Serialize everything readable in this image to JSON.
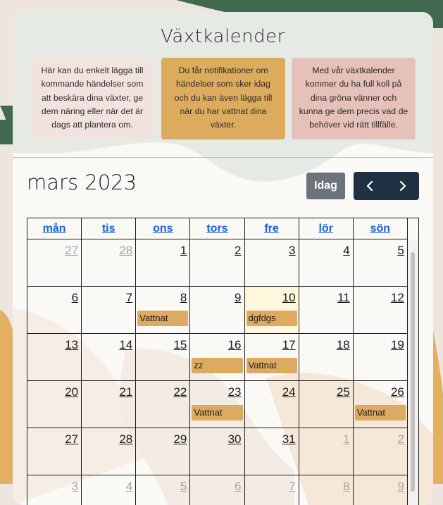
{
  "page": {
    "title": "Växtkalender"
  },
  "info_boxes": [
    {
      "text": "Här kan du enkelt lägga till kommande händelser som att beskära dina växter, ge dem näring eller när det är dags att plantera om."
    },
    {
      "text": "Du får notifikationer om händelser som sker idag och du kan även lägga till när du har vattnat dina växter."
    },
    {
      "text": "Med vår växtkalender kommer du ha full koll på dina gröna vänner och kunna ge dem precis vad de behöver vid rätt tillfälle."
    }
  ],
  "calendar": {
    "month_title": "mars 2023",
    "today_label": "Idag",
    "prev_icon": "chevron-left-icon",
    "next_icon": "chevron-right-icon",
    "weekdays": [
      "mån",
      "tis",
      "ons",
      "tors",
      "fre",
      "lör",
      "sön"
    ],
    "weeks": [
      [
        {
          "n": "27",
          "o": true
        },
        {
          "n": "28",
          "o": true
        },
        {
          "n": "1"
        },
        {
          "n": "2"
        },
        {
          "n": "3"
        },
        {
          "n": "4"
        },
        {
          "n": "5"
        }
      ],
      [
        {
          "n": "6"
        },
        {
          "n": "7"
        },
        {
          "n": "8",
          "ev": "Vattnat"
        },
        {
          "n": "9"
        },
        {
          "n": "10",
          "ev": "dgfdgs",
          "today": true
        },
        {
          "n": "11"
        },
        {
          "n": "12"
        }
      ],
      [
        {
          "n": "13"
        },
        {
          "n": "14"
        },
        {
          "n": "15"
        },
        {
          "n": "16",
          "ev": "zz"
        },
        {
          "n": "17",
          "ev": "Vattnat"
        },
        {
          "n": "18"
        },
        {
          "n": "19"
        }
      ],
      [
        {
          "n": "20"
        },
        {
          "n": "21"
        },
        {
          "n": "22"
        },
        {
          "n": "23",
          "ev": "Vattnat"
        },
        {
          "n": "24"
        },
        {
          "n": "25"
        },
        {
          "n": "26",
          "ev": "Vattnat"
        }
      ],
      [
        {
          "n": "27"
        },
        {
          "n": "28"
        },
        {
          "n": "29"
        },
        {
          "n": "30"
        },
        {
          "n": "31"
        },
        {
          "n": "1",
          "o": true
        },
        {
          "n": "2",
          "o": true
        }
      ],
      [
        {
          "n": "3",
          "o": true
        },
        {
          "n": "4",
          "o": true
        },
        {
          "n": "5",
          "o": true
        },
        {
          "n": "6",
          "o": true
        },
        {
          "n": "7",
          "o": true
        },
        {
          "n": "8",
          "o": true
        },
        {
          "n": "9",
          "o": true
        }
      ]
    ]
  },
  "colors": {
    "accent_green": "#6a8a72",
    "accent_mustard": "#dcab5d",
    "accent_pink": "#e6c1b9",
    "button_dark": "#1f3142",
    "button_gray": "#6b737c",
    "link_blue": "#1a63d4"
  }
}
